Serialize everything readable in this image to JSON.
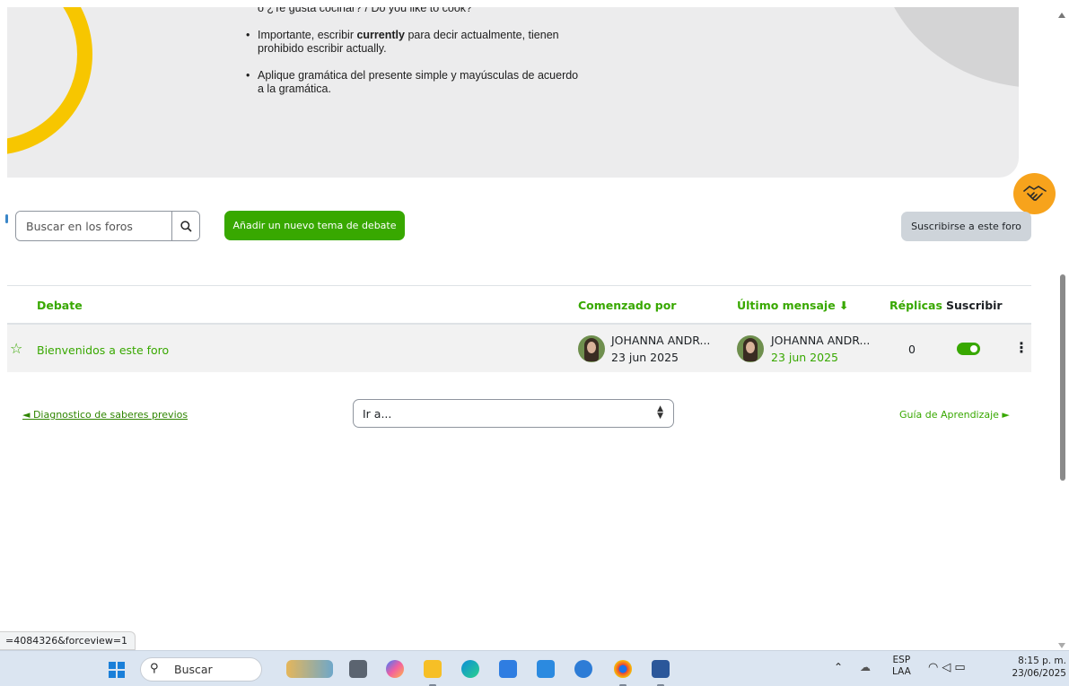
{
  "info": {
    "line_top": "o ¿Te gusta cocinar? / Do you like to cook?",
    "bullet1_a": "Importante, escribir ",
    "bullet1_b": "currently",
    "bullet1_c": " para decir actualmente, tienen prohibido escribir actually.",
    "bullet2": "Aplique gramática del presente simple y mayúsculas de acuerdo a la gramática."
  },
  "toolbar": {
    "search_placeholder": "Buscar en los foros",
    "add_topic_label": "Añadir un nuevo tema de debate",
    "subscribe_label": "Suscribirse a este foro"
  },
  "table": {
    "headers": {
      "debate": "Debate",
      "started_by": "Comenzado por",
      "last_post": "Último mensaje ⬇",
      "replies": "Réplicas",
      "subscribe": "Suscribir"
    },
    "rows": [
      {
        "topic": "Bienvenidos a este foro",
        "started_by_name": "JOHANNA ANDR...",
        "started_by_date": "23 jun 2025",
        "last_post_name": "JOHANNA ANDR...",
        "last_post_date": "23 jun 2025",
        "replies": "0",
        "subscribed": true
      }
    ]
  },
  "nav": {
    "prev_label": "◄ Diagnostico de saberes previos",
    "jump_label": "Ir a...",
    "next_label": "Guía de Aprendizaje ►"
  },
  "status_url": "=4084326&forceview=1",
  "taskbar": {
    "search_label": "Buscar",
    "lang_top": "ESP",
    "lang_bottom": "LAA",
    "time": "8:15 p. m.",
    "date": "23/06/2025"
  },
  "colors": {
    "accent_green": "#38a800",
    "helper_orange": "#f7a31c",
    "arc_yellow": "#f7c600"
  }
}
